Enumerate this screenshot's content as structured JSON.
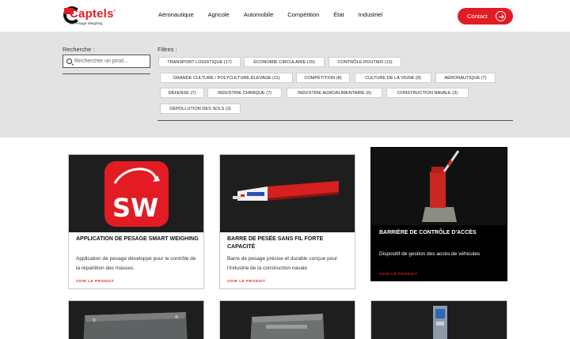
{
  "header": {
    "logo_text": "Captels",
    "logo_reg": "®",
    "logo_tagline": "Le Pesage Weighing",
    "nav": [
      "Aéronautique",
      "Agricole",
      "Automobile",
      "Compétition",
      "État",
      "Industriel"
    ],
    "contact_label": "Contact"
  },
  "search": {
    "label": "Recherche :",
    "placeholder": "Rechercher un prod..."
  },
  "filters": {
    "label": "Filtres :",
    "chips": [
      "TRANSPORT LOGISTIQUE (17)",
      "ÉCONOMIE CIRCULAIRE (15)",
      "CONTRÔLE ROUTIER (13)",
      "GRANDE CULTURE / POLYCULTURE ÉLEVAGE (11)",
      "COMPÉTITION (8)",
      "CULTURE DE LA VIGNE (8)",
      "AÉRONAUTIQUE (7)",
      "DÉFENSE (7)",
      "INDUSTRIE CHIMIQUE (7)",
      "INDUSTRIE AGROALIMENTAIRE (6)",
      "CONSTRUCTION NAVALE (3)",
      "DÉPOLLUTION DES SOLS (3)"
    ]
  },
  "products": [
    {
      "title": "APPLICATION DE PESAGE SMART WEIGHING",
      "description": "Application de pesage développé pour le contrôle de la répartition des masses.",
      "link": "VOIR LE PRODUIT",
      "logo_text": "SW"
    },
    {
      "title": "BARRE DE PESÉE SANS FIL FORTE CAPACITÉ",
      "description": "Barre de pesage précise et durable conçue pour l'industrie de la construction navale",
      "link": "VOIR LE PRODUIT"
    },
    {
      "title": "BARRIÈRE DE CONTRÔLE D'ACCÈS",
      "description": "Dispositif de gestion des accès de véhicules",
      "link": "VOIR LE PRODUIT"
    }
  ],
  "colors": {
    "accent": "#e31b23",
    "band": "#e3e3e3",
    "image_bg": "#1e1e1e"
  }
}
